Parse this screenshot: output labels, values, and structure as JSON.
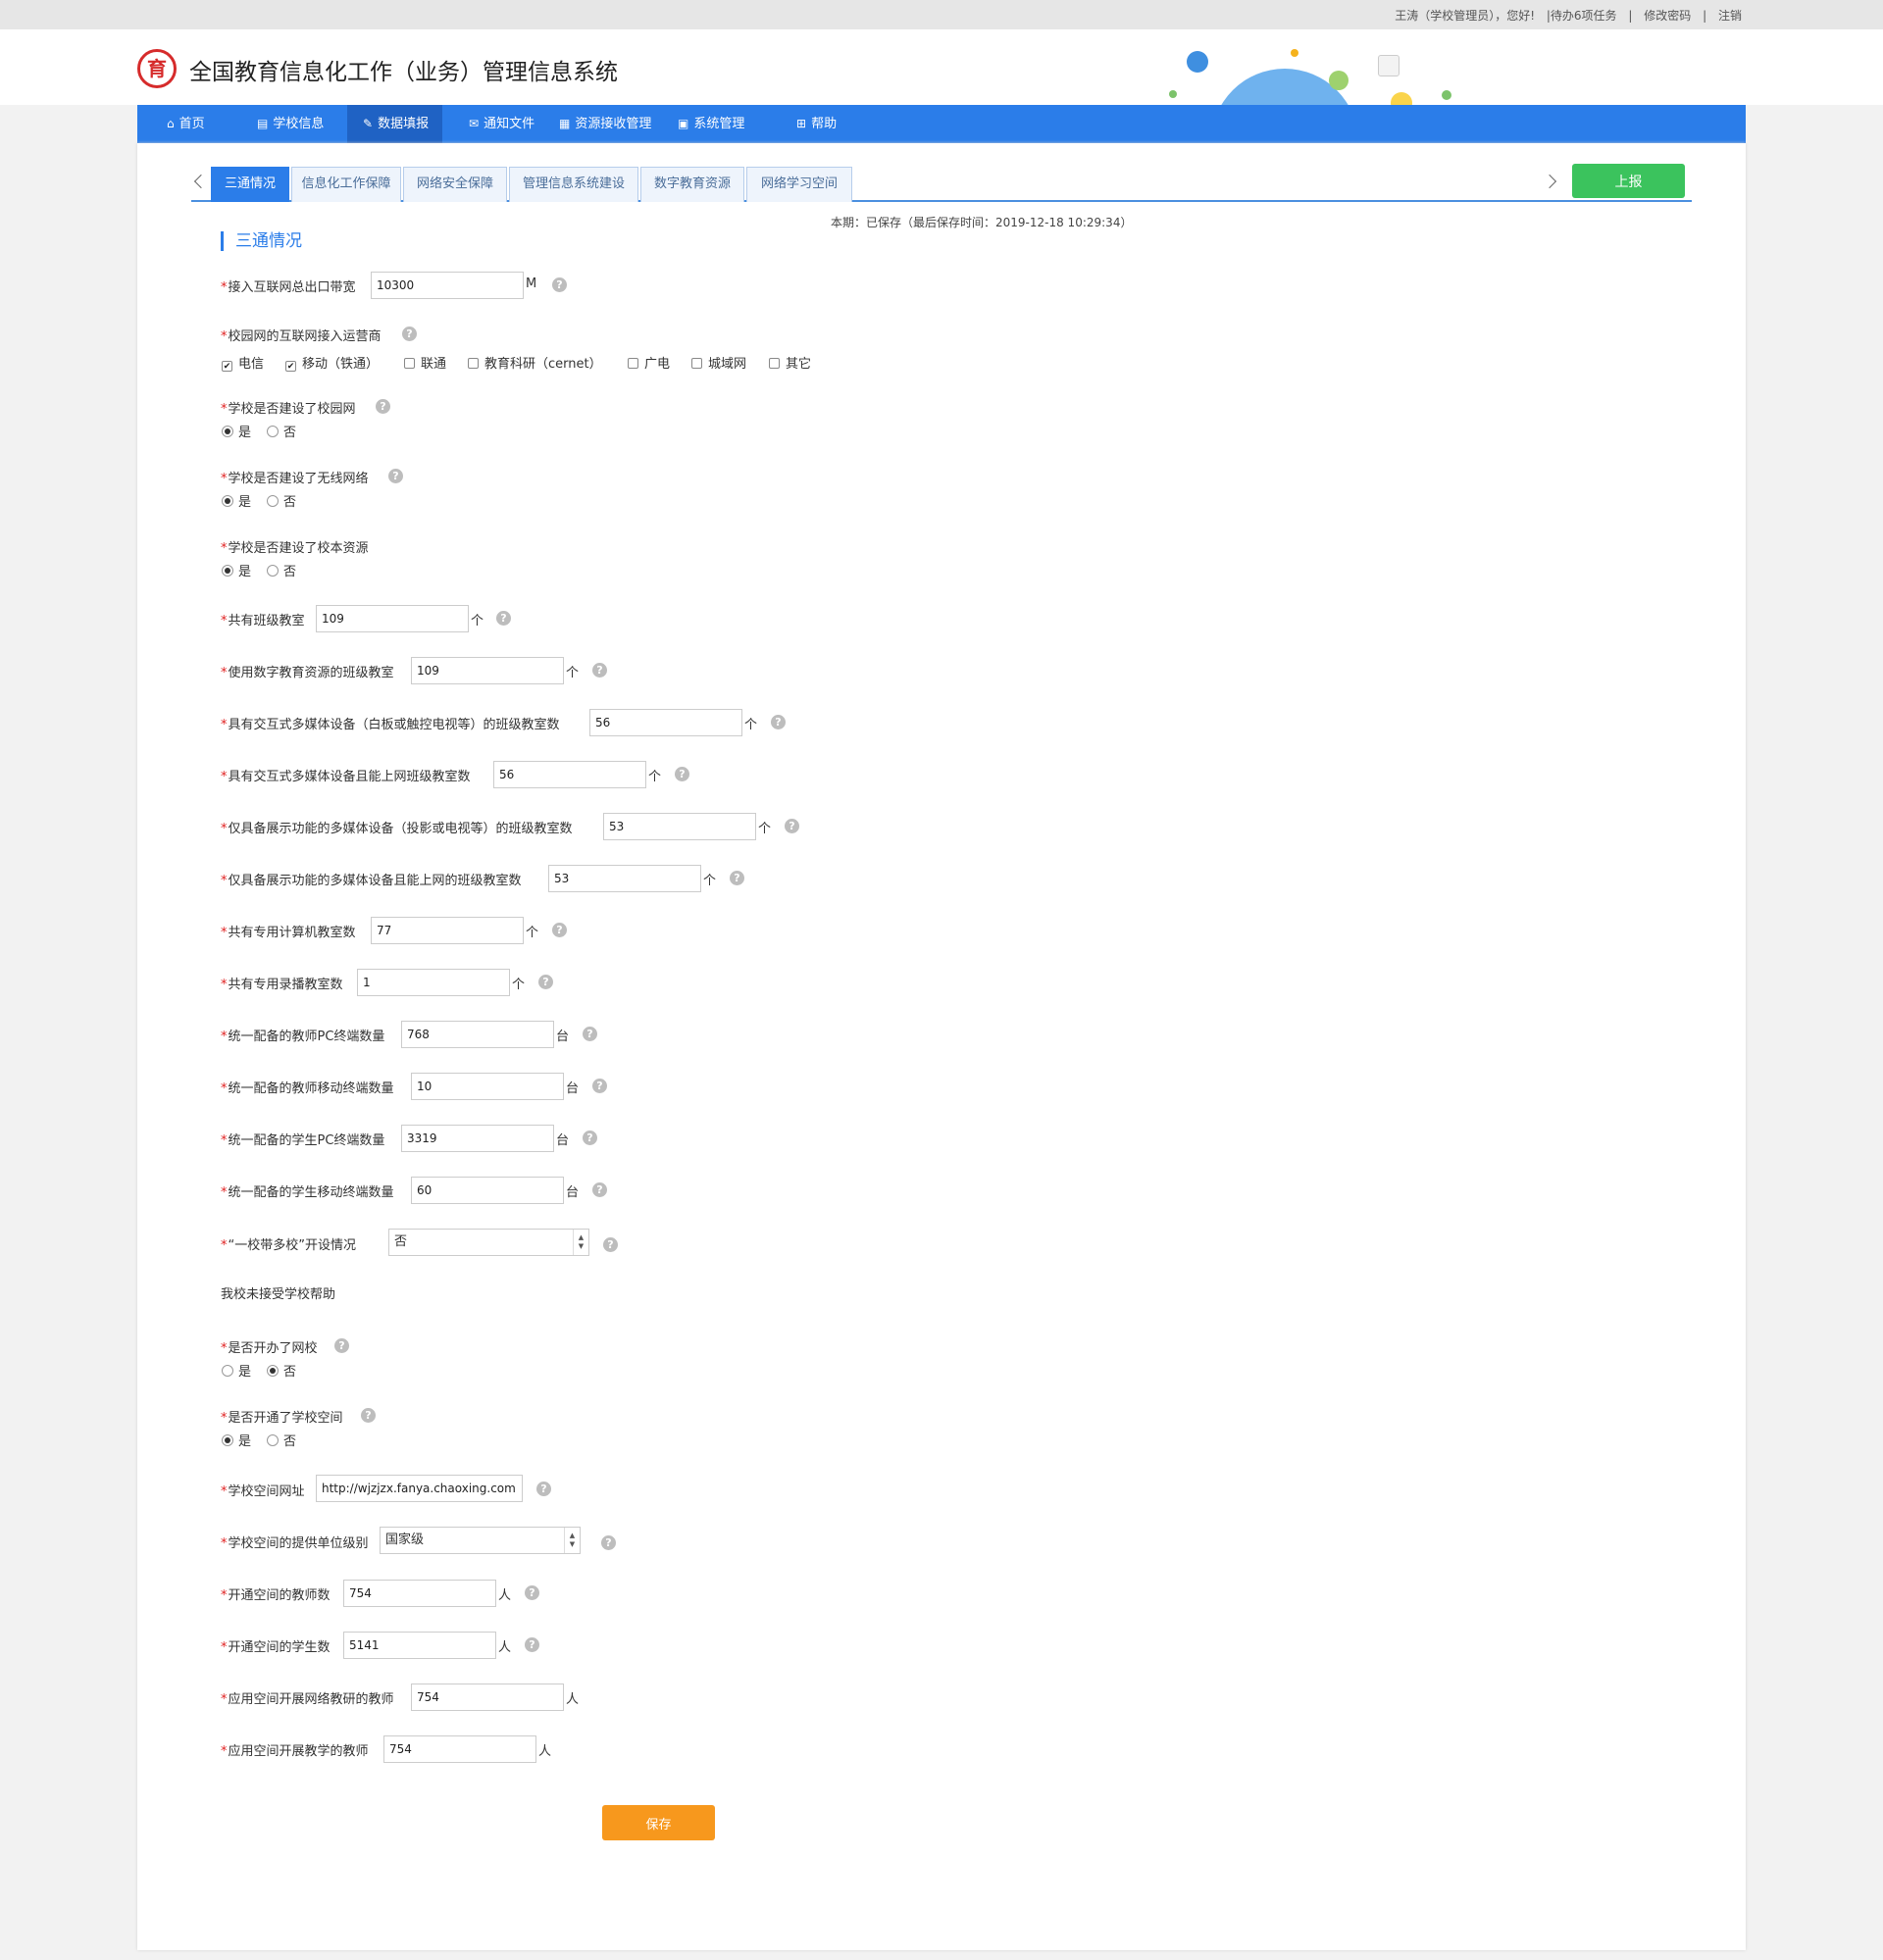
{
  "topbar": {
    "user_greeting": "王涛（学校管理员），您好!",
    "pending": "|待办6项任务",
    "sep1": "|",
    "change_password": "修改密码",
    "sep2": "|",
    "logout": "注销"
  },
  "header": {
    "title": "全国教育信息化工作（业务）管理信息系统",
    "logo_glyph": "育"
  },
  "nav": [
    {
      "label": "首页",
      "icon": "home-icon"
    },
    {
      "label": "学校信息",
      "icon": "clipboard-icon"
    },
    {
      "label": "数据填报",
      "icon": "edit-icon"
    },
    {
      "label": "通知文件",
      "icon": "mail-icon"
    },
    {
      "label": "资源接收管理",
      "icon": "resource-icon"
    },
    {
      "label": "系统管理",
      "icon": "monitor-icon"
    },
    {
      "label": "帮助",
      "icon": "grid-icon"
    }
  ],
  "tabs": [
    "三通情况",
    "信息化工作保障",
    "网络安全保障",
    "管理信息系统建设",
    "数字教育资源",
    "网络学习空间"
  ],
  "report_button": "上报",
  "save_status": "本期：已保存（最后保存时间：2019-12-18 10:29:34）",
  "section_title": "三通情况",
  "required_mark": "*",
  "help_glyph": "?",
  "fields": {
    "bandwidth": {
      "label": "接入互联网总出口带宽",
      "value": "10300",
      "unit": "M"
    },
    "isp": {
      "label": "校园网的互联网接入运营商",
      "options": [
        "电信",
        "移动（铁通）",
        "联通",
        "教育科研（cernet）",
        "广电",
        "城域网",
        "其它"
      ],
      "checked": [
        true,
        true,
        false,
        false,
        false,
        false,
        false
      ]
    },
    "campus_network": {
      "label": "学校是否建设了校园网",
      "yes": "是",
      "no": "否",
      "selected": "是"
    },
    "wireless": {
      "label": "学校是否建设了无线网络",
      "yes": "是",
      "no": "否",
      "selected": "是"
    },
    "school_resources": {
      "label": "学校是否建设了校本资源",
      "yes": "是",
      "no": "否",
      "selected": "是"
    },
    "classrooms": {
      "label": "共有班级教室",
      "value": "109",
      "unit": "个"
    },
    "digital_classrooms": {
      "label": "使用数字教育资源的班级教室",
      "value": "109",
      "unit": "个"
    },
    "interactive_classrooms": {
      "label": "具有交互式多媒体设备（白板或触控电视等）的班级教室数",
      "value": "56",
      "unit": "个"
    },
    "interactive_online": {
      "label": "具有交互式多媒体设备且能上网班级教室数",
      "value": "56",
      "unit": "个"
    },
    "display_classrooms": {
      "label": "仅具备展示功能的多媒体设备（投影或电视等）的班级教室数",
      "value": "53",
      "unit": "个"
    },
    "display_online": {
      "label": "仅具备展示功能的多媒体设备且能上网的班级教室数",
      "value": "53",
      "unit": "个"
    },
    "computer_rooms": {
      "label": "共有专用计算机教室数",
      "value": "77",
      "unit": "个"
    },
    "recording_rooms": {
      "label": "共有专用录播教室数",
      "value": "1",
      "unit": "个"
    },
    "teacher_pc": {
      "label": "统一配备的教师PC终端数量",
      "value": "768",
      "unit": "台"
    },
    "teacher_mobile": {
      "label": "统一配备的教师移动终端数量",
      "value": "10",
      "unit": "台"
    },
    "student_pc": {
      "label": "统一配备的学生PC终端数量",
      "value": "3319",
      "unit": "台"
    },
    "student_mobile": {
      "label": "统一配备的学生移动终端数量",
      "value": "60",
      "unit": "台"
    },
    "one_school_many": {
      "label": "“一校带多校”开设情况",
      "value": "否"
    },
    "note": "我校未接受学校帮助",
    "online_school": {
      "label": "是否开办了网校",
      "yes": "是",
      "no": "否",
      "selected": "否"
    },
    "school_space": {
      "label": "是否开通了学校空间",
      "yes": "是",
      "no": "否",
      "selected": "是"
    },
    "space_url": {
      "label": "学校空间网址",
      "value": "http://wjzjzx.fanya.chaoxing.com"
    },
    "space_provider_level": {
      "label": "学校空间的提供单位级别",
      "value": "国家级"
    },
    "space_teachers": {
      "label": "开通空间的教师数",
      "value": "754",
      "unit": "人"
    },
    "space_students": {
      "label": "开通空间的学生数",
      "value": "5141",
      "unit": "人"
    },
    "research_teachers": {
      "label": "应用空间开展网络教研的教师",
      "value": "754",
      "unit": "人"
    },
    "teaching_teachers": {
      "label": "应用空间开展教学的教师",
      "value": "754",
      "unit": "人"
    }
  },
  "save_button": "保存"
}
